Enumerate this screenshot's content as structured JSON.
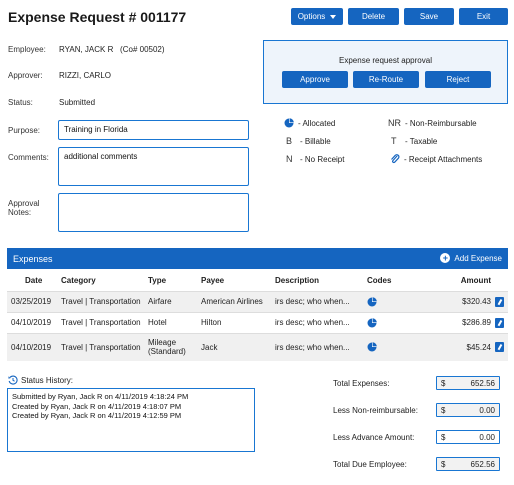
{
  "header": {
    "title": "Expense Request # 001177",
    "options_label": "Options",
    "delete_label": "Delete",
    "save_label": "Save",
    "exit_label": "Exit"
  },
  "form": {
    "employee_label": "Employee:",
    "employee_value": "RYAN, JACK R   (Co# 00502)",
    "approver_label": "Approver:",
    "approver_value": "RIZZI, CARLO",
    "status_label": "Status:",
    "status_value": "Submitted",
    "purpose_label": "Purpose:",
    "purpose_value": "Training in Florida",
    "comments_label": "Comments:",
    "comments_value": "additional comments",
    "approval_notes_label": "Approval Notes:",
    "approval_notes_value": ""
  },
  "approval": {
    "title": "Expense request approval",
    "approve_label": "Approve",
    "reroute_label": "Re-Route",
    "reject_label": "Reject"
  },
  "legend": {
    "allocated": "- Allocated",
    "billable_code": "B",
    "billable": "- Billable",
    "no_receipt_code": "N",
    "no_receipt": "- No Receipt",
    "non_reimbursable_code": "NR",
    "non_reimbursable": "- Non-Reimbursable",
    "taxable_code": "T",
    "taxable": "- Taxable",
    "receipt_attachments": "- Receipt Attachments"
  },
  "expenses": {
    "title": "Expenses",
    "add_label": "Add Expense",
    "columns": {
      "date": "Date",
      "category": "Category",
      "type": "Type",
      "payee": "Payee",
      "description": "Description",
      "codes": "Codes",
      "amount": "Amount"
    },
    "rows": [
      {
        "date": "03/25/2019",
        "category": "Travel | Transportation",
        "type": "Airfare",
        "payee": "American Airlines",
        "description": "irs desc; who when...",
        "amount": "$320.43"
      },
      {
        "date": "04/10/2019",
        "category": "Travel | Transportation",
        "type": "Hotel",
        "payee": "Hilton",
        "description": "irs desc; who when...",
        "amount": "$286.89"
      },
      {
        "date": "04/10/2019",
        "category": "Travel | Transportation",
        "type": "Mileage (Standard)",
        "payee": "Jack",
        "description": "irs desc; who when...",
        "amount": "$45.24"
      }
    ]
  },
  "status_history": {
    "label": "Status History:",
    "lines": [
      "Submitted by Ryan, Jack R on 4/11/2019 4:18:24 PM",
      "Created by Ryan, Jack R on 4/11/2019 4:18:07 PM",
      "Created by Ryan, Jack R on 4/11/2019 4:12:59 PM"
    ]
  },
  "totals": {
    "currency": "$",
    "total_expenses_label": "Total Expenses:",
    "total_expenses": "652.56",
    "less_nonreimb_label": "Less Non-reimbursable:",
    "less_nonreimb": "0.00",
    "less_advance_label": "Less Advance Amount:",
    "less_advance": "0.00",
    "total_due_label": "Total Due Employee:",
    "total_due": "652.56"
  },
  "colors": {
    "accent": "#1565c0",
    "border": "#1976d2",
    "approval_bg": "#eef4fb"
  },
  "icons": [
    "caret-down-icon",
    "pie-chart-icon",
    "plus-circle-icon",
    "edit-icon",
    "paperclip-icon",
    "history-icon"
  ]
}
